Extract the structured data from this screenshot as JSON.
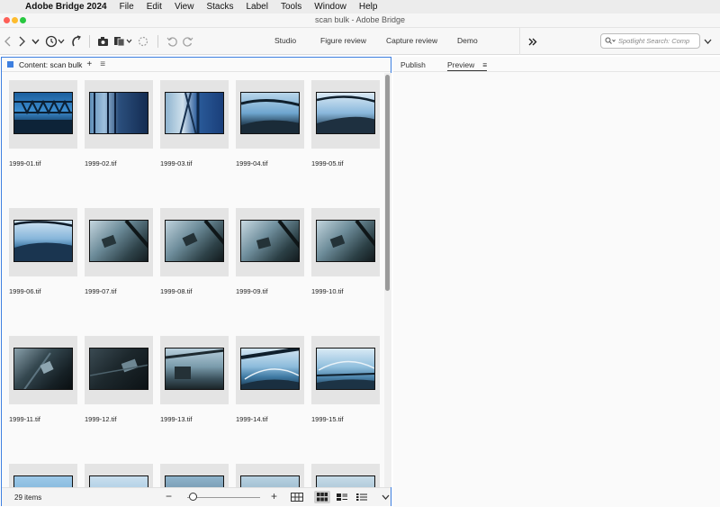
{
  "menubar": {
    "app_name": "Adobe Bridge 2024",
    "items": [
      "File",
      "Edit",
      "View",
      "Stacks",
      "Label",
      "Tools",
      "Window",
      "Help"
    ]
  },
  "window": {
    "title": "scan bulk - Adobe Bridge"
  },
  "toolbar": {
    "workspaces": [
      "Studio",
      "Figure review",
      "Capture review",
      "Demo"
    ],
    "search_placeholder": "Spotlight Search: Comp"
  },
  "content_panel": {
    "tab_label": "Content: scan bulk",
    "files": [
      {
        "name": "1999-01.tif"
      },
      {
        "name": "1999-02.tif"
      },
      {
        "name": "1999-03.tif"
      },
      {
        "name": "1999-04.tif"
      },
      {
        "name": "1999-05.tif"
      },
      {
        "name": "1999-06.tif"
      },
      {
        "name": "1999-07.tif"
      },
      {
        "name": "1999-08.tif"
      },
      {
        "name": "1999-09.tif"
      },
      {
        "name": "1999-10.tif"
      },
      {
        "name": "1999-11.tif"
      },
      {
        "name": "1999-12.tif"
      },
      {
        "name": "1999-13.tif"
      },
      {
        "name": "1999-14.tif"
      },
      {
        "name": "1999-15.tif"
      }
    ],
    "item_count": "29 items"
  },
  "right_panel": {
    "tabs": [
      "Publish",
      "Preview"
    ]
  },
  "colors": {
    "accent": "#3d7fe0"
  }
}
